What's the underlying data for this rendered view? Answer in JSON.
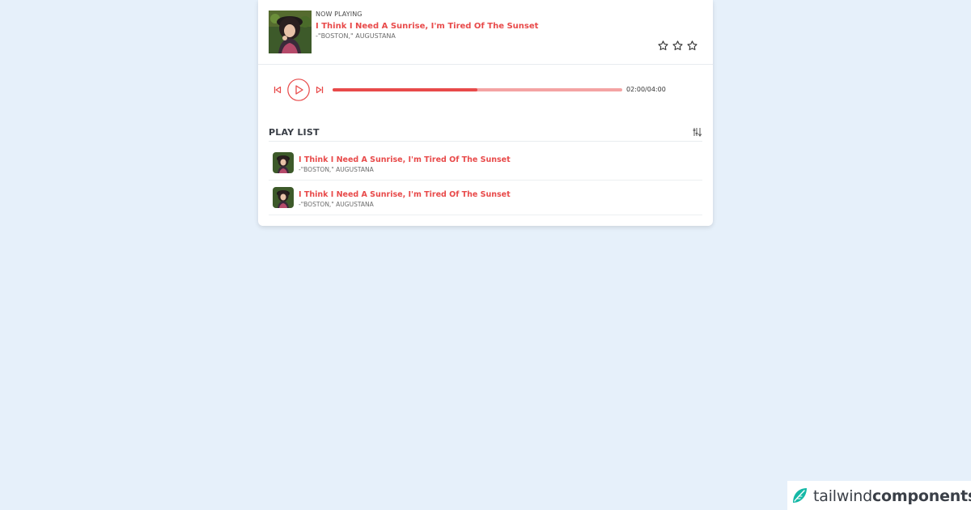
{
  "now_playing": {
    "label": "NOW PLAYING",
    "title": "I Think I Need A Sunrise, I'm Tired Of The Sunset",
    "artist": "-\"BOSTON,\" AUGUSTANA",
    "rating_max": 3
  },
  "player": {
    "time": "02:00/04:00",
    "progress": 0.5,
    "accent": "#e84a4a",
    "track_color": "#f4a3a3"
  },
  "playlist": {
    "title": "PLAY LIST",
    "items": [
      {
        "title": "I Think I Need A Sunrise, I'm Tired Of The Sunset",
        "artist": "-\"BOSTON,\" AUGUSTANA"
      },
      {
        "title": "I Think I Need A Sunrise, I'm Tired Of The Sunset",
        "artist": "-\"BOSTON,\" AUGUSTANA"
      }
    ]
  },
  "brand": {
    "name_light": "tailwind",
    "name_bold": "components",
    "color": "#14b8a6"
  },
  "icons": {
    "prev": "skip-back-icon",
    "play": "play-icon",
    "next": "skip-forward-icon",
    "star": "star-outline-icon",
    "settings": "sliders-icon"
  }
}
